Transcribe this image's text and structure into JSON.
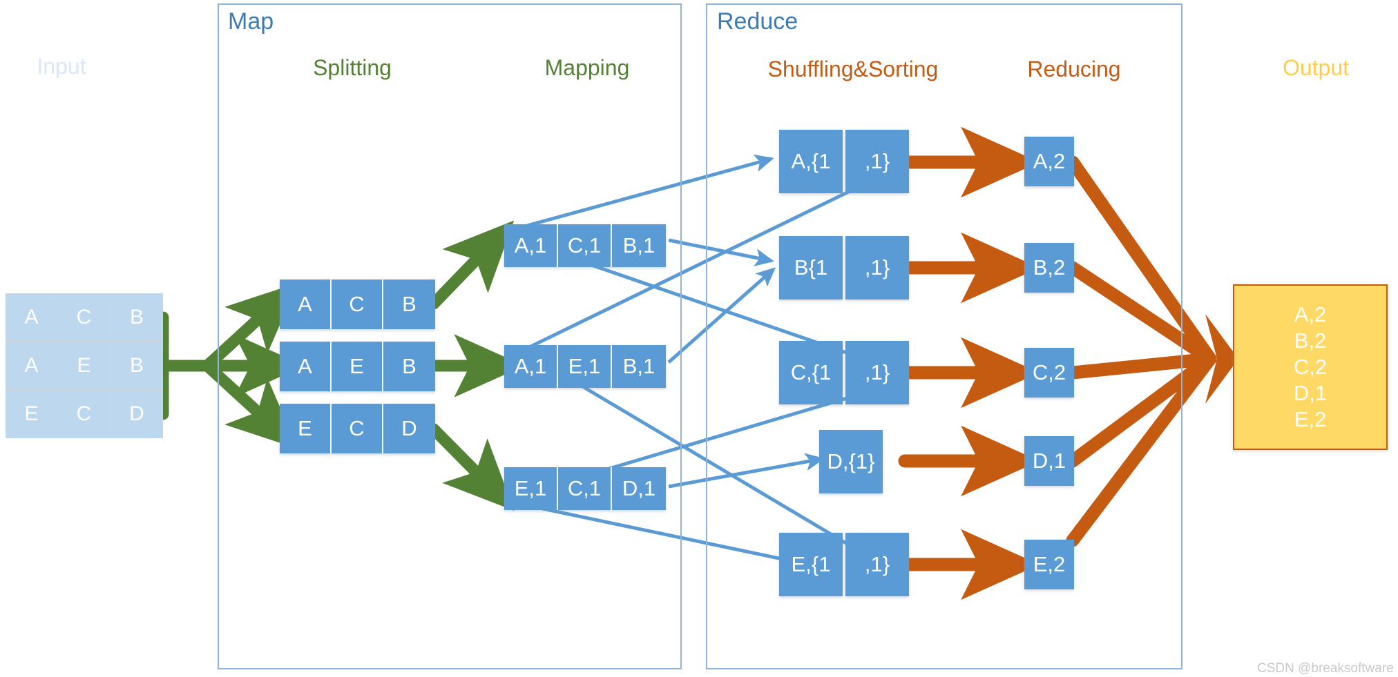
{
  "panels": {
    "map": {
      "title": "Map"
    },
    "reduce": {
      "title": "Reduce"
    }
  },
  "stage_labels": {
    "input": "Input",
    "splitting": "Splitting",
    "mapping": "Mapping",
    "shuffling": "Shuffling&Sorting",
    "reducing": "Reducing",
    "output": "Output"
  },
  "colors": {
    "panel_border": "#8fb4d9",
    "panel_title": "#3b7cb5",
    "input_label": "#dbe7f4",
    "green_label": "#548235",
    "orange_label": "#c55a11",
    "output_label": "#ffcc4d",
    "box_blue": "#5b9bd5",
    "input_grid": "#bdd7ee",
    "green_arrow": "#548235",
    "blue_arrow": "#5b9bd5",
    "orange_arrow": "#c55a11",
    "output_fill": "#ffd966",
    "output_border": "#c55a11",
    "watermark": "#c9c9c9"
  },
  "input_grid": {
    "rows": [
      [
        "A",
        "C",
        "B"
      ],
      [
        "A",
        "E",
        "B"
      ],
      [
        "E",
        "C",
        "D"
      ]
    ]
  },
  "splitting": {
    "rows": [
      [
        "A",
        "C",
        "B"
      ],
      [
        "A",
        "E",
        "B"
      ],
      [
        "E",
        "C",
        "D"
      ]
    ]
  },
  "mapping": {
    "rows": [
      [
        "A,1",
        "C,1",
        "B,1"
      ],
      [
        "A,1",
        "E,1",
        "B,1"
      ],
      [
        "E,1",
        "C,1",
        "D,1"
      ]
    ]
  },
  "shuffling": {
    "rows": [
      {
        "cells": [
          "A,{1",
          ",1}"
        ]
      },
      {
        "cells": [
          "B{1",
          ",1}"
        ]
      },
      {
        "cells": [
          "C,{1",
          ",1}"
        ]
      },
      {
        "cells": [
          "D,{1}"
        ]
      },
      {
        "cells": [
          "E,{1",
          ",1}"
        ]
      }
    ]
  },
  "reducing": {
    "boxes": [
      "A,2",
      "B,2",
      "C,2",
      "D,1",
      "E,2"
    ]
  },
  "output": {
    "lines": [
      "A,2",
      "B,2",
      "C,2",
      "D,1",
      "E,2"
    ]
  },
  "watermark": {
    "text": "CSDN @breaksoftware"
  }
}
